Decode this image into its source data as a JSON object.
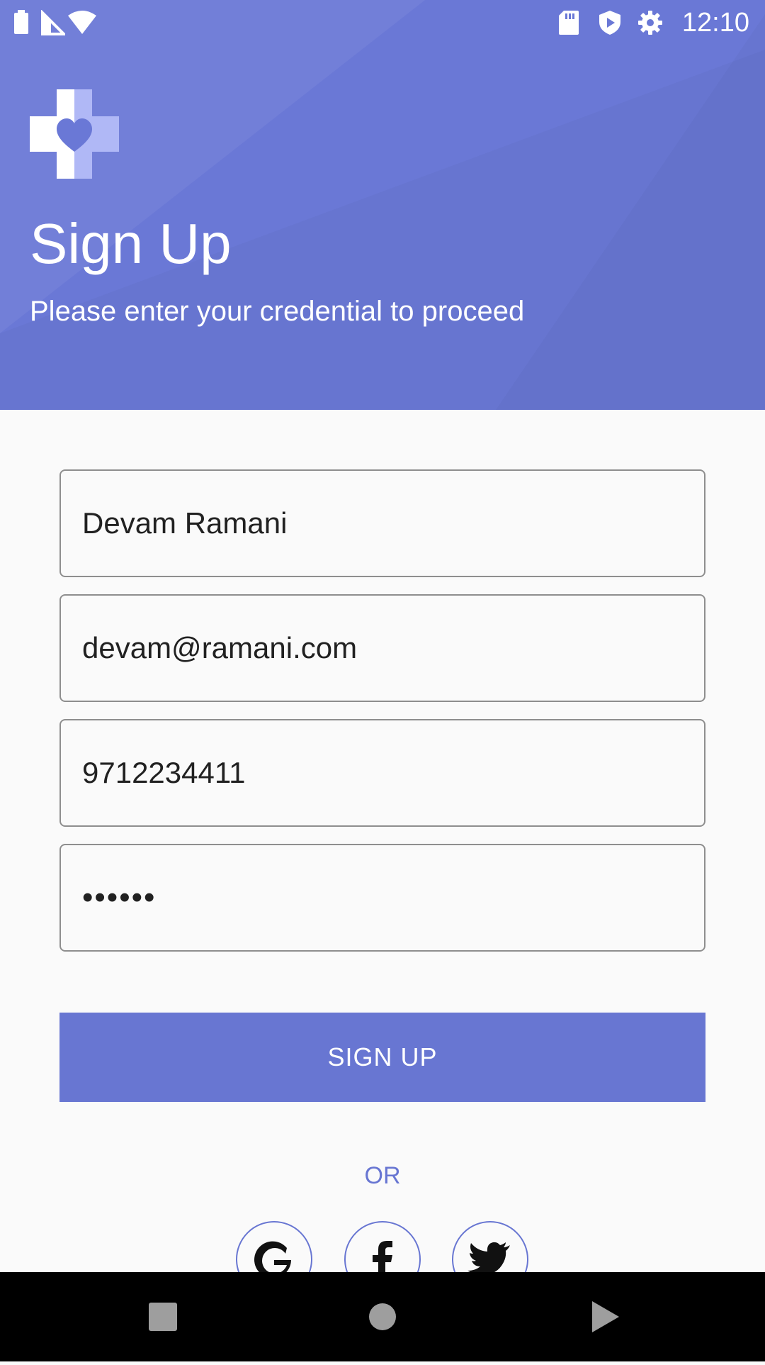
{
  "status_bar": {
    "time": "12:10",
    "icons": [
      "battery-icon",
      "cell-signal-icon",
      "wifi-icon",
      "sd-card-icon",
      "shield-play-icon",
      "gear-icon"
    ]
  },
  "header": {
    "logo_icon": "medical-cross-heart-icon",
    "title": "Sign Up",
    "subtitle": "Please enter your credential to proceed",
    "background_color": "#6a78d6"
  },
  "form": {
    "name_value": "Devam Ramani",
    "email_value": "devam@ramani.com",
    "phone_value": "9712234411",
    "password_value": "••••••"
  },
  "signup_button_label": "SIGN UP",
  "or_label": "OR",
  "social_buttons": [
    {
      "icon": "google-icon"
    },
    {
      "icon": "facebook-icon"
    },
    {
      "icon": "twitter-icon"
    }
  ],
  "nav_bar": {
    "icons": [
      "recents-square-icon",
      "home-circle-icon",
      "back-triangle-icon"
    ]
  },
  "colors": {
    "accent": "#6876d2",
    "field_border": "#8e8e8e",
    "page_background": "#fafafa",
    "text_dark": "#212121"
  }
}
